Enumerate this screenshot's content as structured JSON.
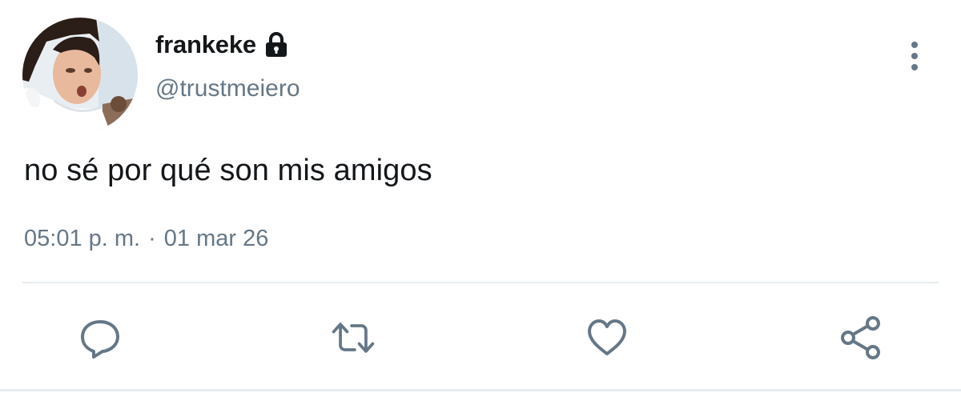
{
  "user": {
    "display_name": "frankeke",
    "handle": "@trustmeiero",
    "protected": true
  },
  "tweet": {
    "text": "no sé por qué son mis amigos",
    "time": "05:01 p. m.",
    "separator": "·",
    "date": "01 mar 26"
  },
  "icons": {
    "lock": "lock-icon",
    "more": "more-vertical-icon",
    "reply": "reply-icon",
    "retweet": "retweet-icon",
    "like": "heart-icon",
    "share": "share-icon"
  },
  "colors": {
    "text_primary": "#14171a",
    "text_secondary": "#657786",
    "icon_gray": "#657786",
    "divider": "#e6ecf0"
  }
}
